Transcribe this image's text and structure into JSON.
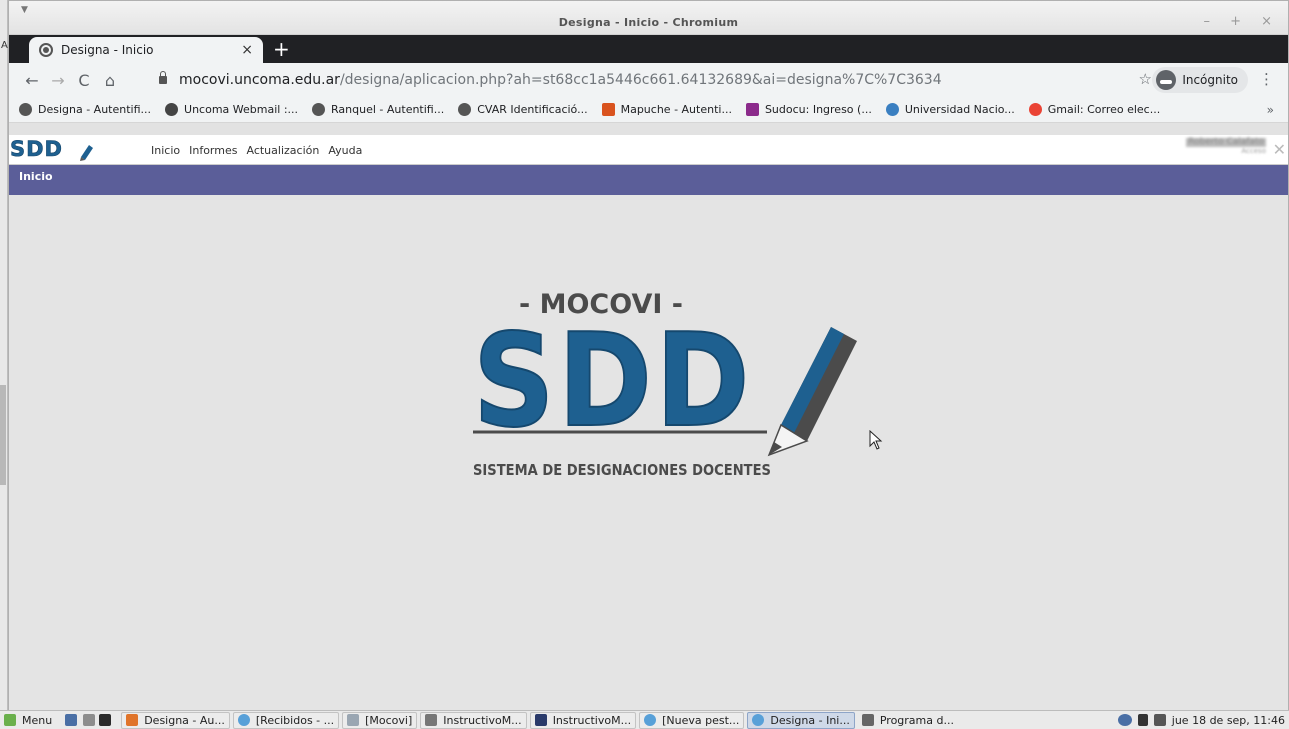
{
  "window": {
    "title": "Designa - Inicio - Chromium",
    "left_letter": "A",
    "controls": "– + ×"
  },
  "tab": {
    "label": "Designa - Inicio",
    "close": "×",
    "new_tab": "+"
  },
  "toolbar": {
    "back": "←",
    "forward": "→",
    "reload": "C",
    "home": "⌂",
    "url_host": "mocovi.uncoma.edu.ar",
    "url_path": "/designa/aplicacion.php?ah=st68cc1a5446c661.64132689&ai=designa%7C%7C3634",
    "star": "☆",
    "incognito_label": "Incógnito",
    "menu": "⋮"
  },
  "bookmarks": [
    {
      "label": "Designa - Autentifi...",
      "color": "#555555"
    },
    {
      "label": "Uncoma Webmail :...",
      "color": "#444444"
    },
    {
      "label": "Ranquel - Autentifi...",
      "color": "#555555"
    },
    {
      "label": "CVAR Identificació...",
      "color": "#555555"
    },
    {
      "label": "Mapuche - Autenti...",
      "color": "#d9531e"
    },
    {
      "label": "Sudocu: Ingreso (...",
      "color": "#8b2a8b"
    },
    {
      "label": "Universidad Nacio...",
      "color": "#3a7fc1"
    },
    {
      "label": "Gmail: Correo elec...",
      "color": "#ea4335"
    }
  ],
  "bookmarks_more": "»",
  "app": {
    "logo_text": "SDD",
    "nav": [
      "Inicio",
      "Informes",
      "Actualización",
      "Ayuda"
    ],
    "user_name": "Roberto Calafato",
    "user_role": "Acceso",
    "close_icon": "close-icon",
    "band_title": "Inicio",
    "hero": {
      "top_text": "- MOCOVI -",
      "logo_text": "SDD",
      "subtitle": "SISTEMA DE DESIGNACIONES DOCENTES",
      "brand_color": "#1e6090",
      "pencil_color": "#4b4b4b"
    }
  },
  "taskbar": {
    "menu_label": "Menu",
    "items": [
      {
        "label": "Designa - Au...",
        "color": "#e0742a"
      },
      {
        "label": "[Recibidos - ...",
        "color": "#58a0d8"
      },
      {
        "label": "[Mocovi]",
        "color": "#9aa6b2"
      },
      {
        "label": "InstructivoM...",
        "color": "#777777"
      },
      {
        "label": "InstructivoM...",
        "color": "#2a3a6a"
      },
      {
        "label": "[Nueva pest...",
        "color": "#58a0d8"
      },
      {
        "label": "Designa - Ini...",
        "color": "#58a0d8"
      },
      {
        "label": "Programa d...",
        "color": "#666666"
      }
    ],
    "active_index": 6,
    "clock": "jue 18 de sep, 11:46"
  }
}
